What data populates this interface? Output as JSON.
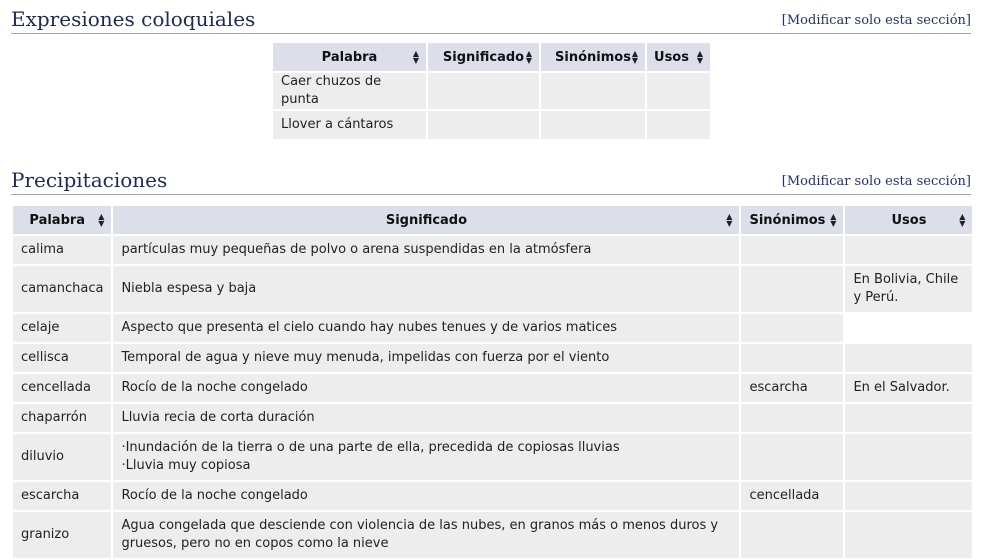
{
  "section1": {
    "title": "Expresiones coloquiales",
    "edit_link": "Modificar solo esta sección",
    "table": {
      "headers": [
        "Palabra",
        "Significado",
        "Sinónimos",
        "Usos"
      ],
      "rows": [
        [
          "Caer chuzos de punta",
          "",
          "",
          ""
        ],
        [
          "Llover a cántaros",
          "",
          "",
          ""
        ]
      ]
    }
  },
  "section2": {
    "title": "Precipitaciones",
    "edit_link": "Modificar solo esta sección",
    "table": {
      "headers": [
        "Palabra",
        "Significado",
        "Sinónimos",
        "Usos"
      ],
      "rows": [
        [
          "calima",
          "partículas muy pequeñas de polvo o arena suspendidas en la atmósfera",
          "",
          ""
        ],
        [
          "camanchaca",
          "Niebla espesa y baja",
          "",
          "En Bolivia, Chile y Perú."
        ],
        [
          "celaje",
          "Aspecto que presenta el cielo cuando hay nubes tenues y de varios matices",
          "",
          ""
        ],
        [
          "cellisca",
          "Temporal de agua y nieve muy menuda, impelidas con fuerza por el viento",
          "",
          ""
        ],
        [
          "cencellada",
          "Rocío de la noche congelado",
          "escarcha",
          "En el Salvador."
        ],
        [
          "chaparrón",
          "Lluvia recia de corta duración",
          "",
          ""
        ],
        [
          "diluvio",
          [
            "Inundación de la tierra o de una parte de ella, precedida de copiosas lluvias",
            "Lluvia muy copiosa"
          ],
          "",
          ""
        ],
        [
          "escarcha",
          "Rocío de la noche congelado",
          "cencellada",
          ""
        ],
        [
          "granizo",
          "Agua congelada que desciende con violencia de las nubes, en granos más o menos duros y gruesos, pero no en copos como la nieve",
          "",
          ""
        ]
      ]
    }
  }
}
